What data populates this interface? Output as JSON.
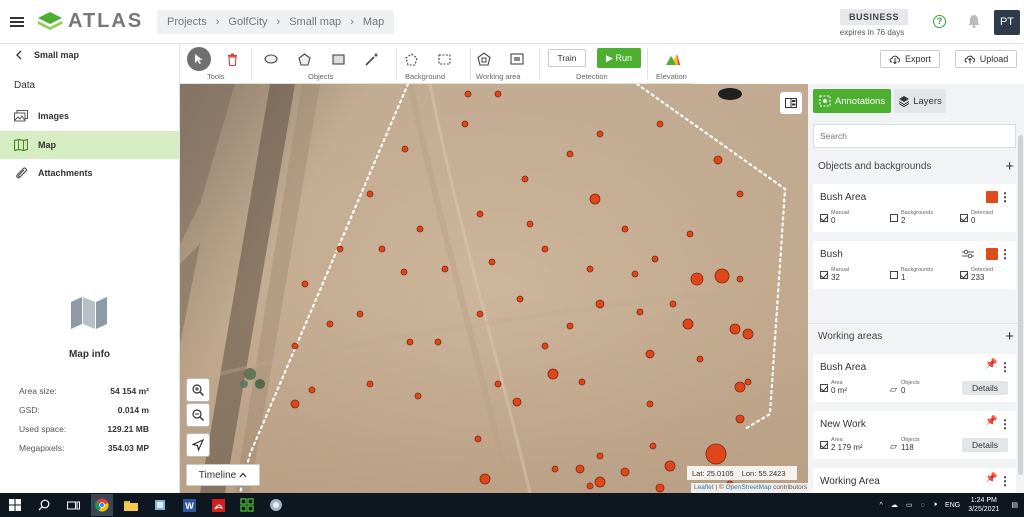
{
  "app": {
    "logo_text": "ATLAS"
  },
  "breadcrumb": [
    "Projects",
    "GolfCity",
    "Small map",
    "Map"
  ],
  "plan": {
    "badge": "BUSINESS",
    "expiry": "expires in 76 days"
  },
  "user": {
    "initials": "PT"
  },
  "sidebar": {
    "back_title": "Small map",
    "section": "Data",
    "items": [
      {
        "label": "Images",
        "icon": "images-icon"
      },
      {
        "label": "Map",
        "icon": "map-icon",
        "active": true
      },
      {
        "label": "Attachments",
        "icon": "paperclip-icon"
      }
    ],
    "map_info": {
      "title": "Map info",
      "rows": [
        {
          "key": "Area size:",
          "value": "54 154 m²"
        },
        {
          "key": "GSD:",
          "value": "0.014 m"
        },
        {
          "key": "Used space:",
          "value": "129.21 MB"
        },
        {
          "key": "Megapixels:",
          "value": "354.03 MP"
        }
      ]
    }
  },
  "toolbar": {
    "groups": [
      "Tools",
      "Objects",
      "Background",
      "Working area",
      "Detection",
      "Elevation"
    ],
    "train": "Train",
    "run": "Run"
  },
  "actions": {
    "export": "Export",
    "upload": "Upload"
  },
  "map": {
    "timeline": "Timeline",
    "lat": "Lat: 25.0105",
    "lon": "Lon: 55.2423",
    "attribution_leaflet": "Leaflet",
    "attribution_sep": " | © ",
    "attribution_osm": "OpenStreetMap",
    "attribution_tail": " contributors"
  },
  "panel": {
    "tabs": [
      "Annotations",
      "Layers"
    ],
    "search_placeholder": "Search",
    "objects_section": "Objects and backgrounds",
    "objects": [
      {
        "name": "Bush Area",
        "manual_label": "Manual",
        "manual": "0",
        "bg_label": "Backgrounds",
        "bg": "2",
        "det_label": "Detected",
        "det": "0",
        "color": "#e14b1c"
      },
      {
        "name": "Bush",
        "manual_label": "Manual",
        "manual": "32",
        "bg_label": "Backgrounds",
        "bg": "1",
        "det_label": "Detected",
        "det": "233",
        "color": "#e14b1c"
      }
    ],
    "areas_section": "Working areas",
    "areas": [
      {
        "name": "Bush Area",
        "area_label": "Area",
        "area": "0 m²",
        "obj_label": "Objects",
        "objects": "0",
        "details": "Details"
      },
      {
        "name": "New Work",
        "area_label": "Area",
        "area": "2 179 m²",
        "obj_label": "Objects",
        "objects": "118",
        "details": "Details"
      },
      {
        "name": "Working Area"
      }
    ]
  },
  "taskbar": {
    "time": "1:24 PM",
    "date": "3/25/2021",
    "lang": "ENG"
  }
}
